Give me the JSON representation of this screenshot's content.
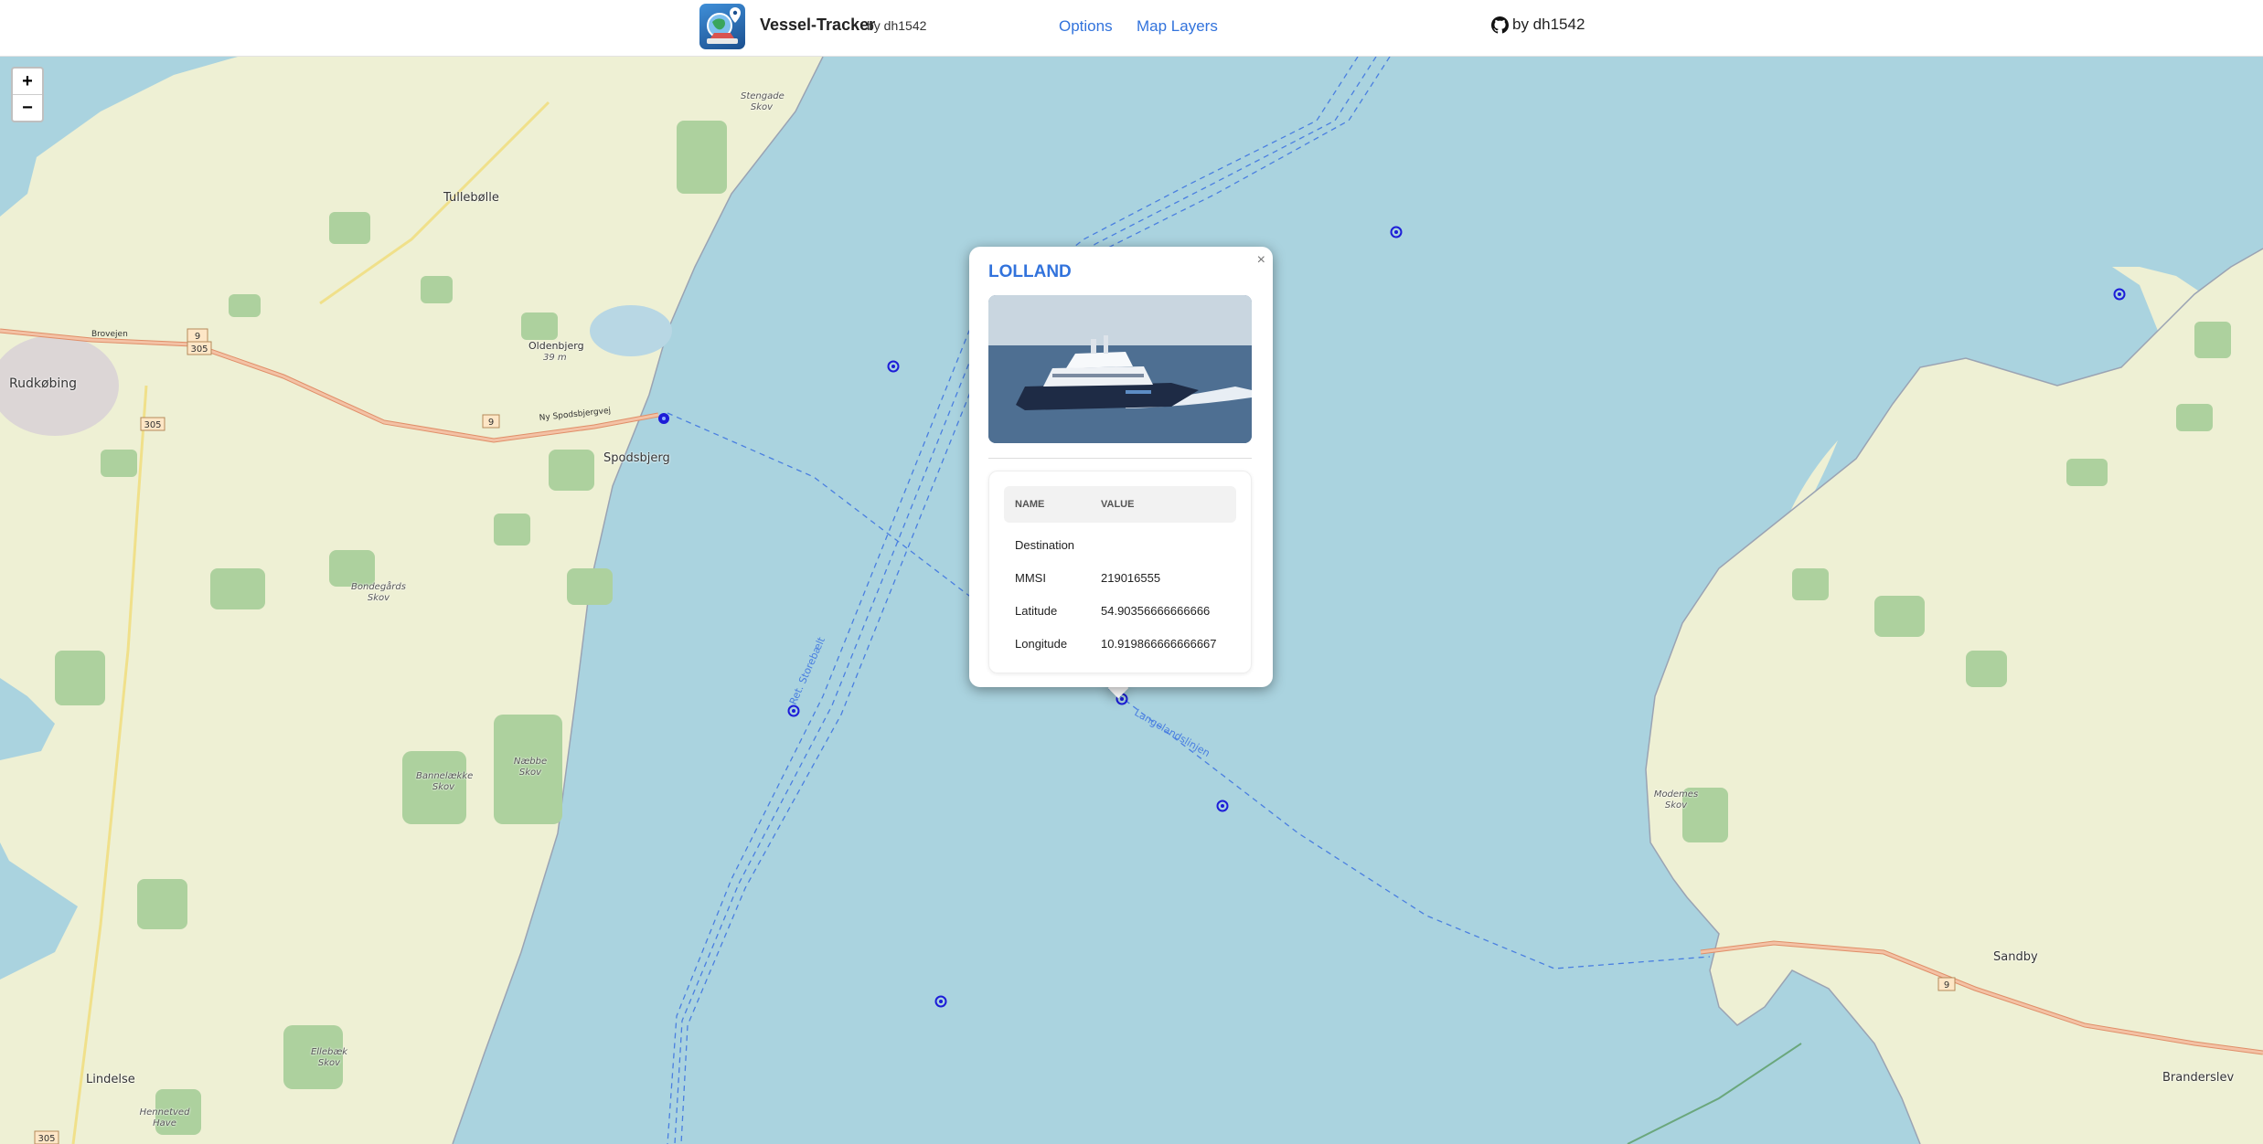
{
  "navbar": {
    "title": "Vessel-Tracker",
    "by": "by dh1542",
    "links": [
      "Options",
      "Map Layers"
    ],
    "github": "by dh1542"
  },
  "map": {
    "zoom_in": "+",
    "zoom_out": "−",
    "places": {
      "rudkobing": "Rudkøbing",
      "tullebolle": "Tullebølle",
      "spodsbjerg": "Spodsbjerg",
      "lindelse": "Lindelse",
      "sandby": "Sandby",
      "branderslev": "Branderslev",
      "oldenbjerg": "Oldenbjerg",
      "oldenbjerg_height": "39 m",
      "stengade_skov": "Stengade Skov",
      "bondegaards_skov": "Bondegårds Skov",
      "baennelokke_skov": "Bannelække Skov",
      "naebbe_skov": "Næbbe Skov",
      "ellebaek_skov": "Ellebæk Skov",
      "hennetved_have": "Hennetved Have",
      "modemes_skov": "Modemes Skov",
      "route_langelandslinjen": "Langelandslinjen",
      "route_ret": "Ret. Storebælt",
      "road_9": "9",
      "road_305": "305",
      "road_ny_spodsbjergvej": "Ny Spodsbjergvej",
      "road_brovejen": "Brovejen"
    },
    "accent_color": "#3273dc",
    "water_color": "#aad3df",
    "land_color": "#f2efe9"
  },
  "popup": {
    "close": "×",
    "vessel_name": "LOLLAND",
    "table_headers": [
      "NAME",
      "VALUE"
    ],
    "rows": [
      {
        "name": "Destination",
        "value": ""
      },
      {
        "name": "MMSI",
        "value": "219016555"
      },
      {
        "name": "Latitude",
        "value": "54.90356666666666"
      },
      {
        "name": "Longitude",
        "value": "10.919866666666667"
      }
    ]
  }
}
